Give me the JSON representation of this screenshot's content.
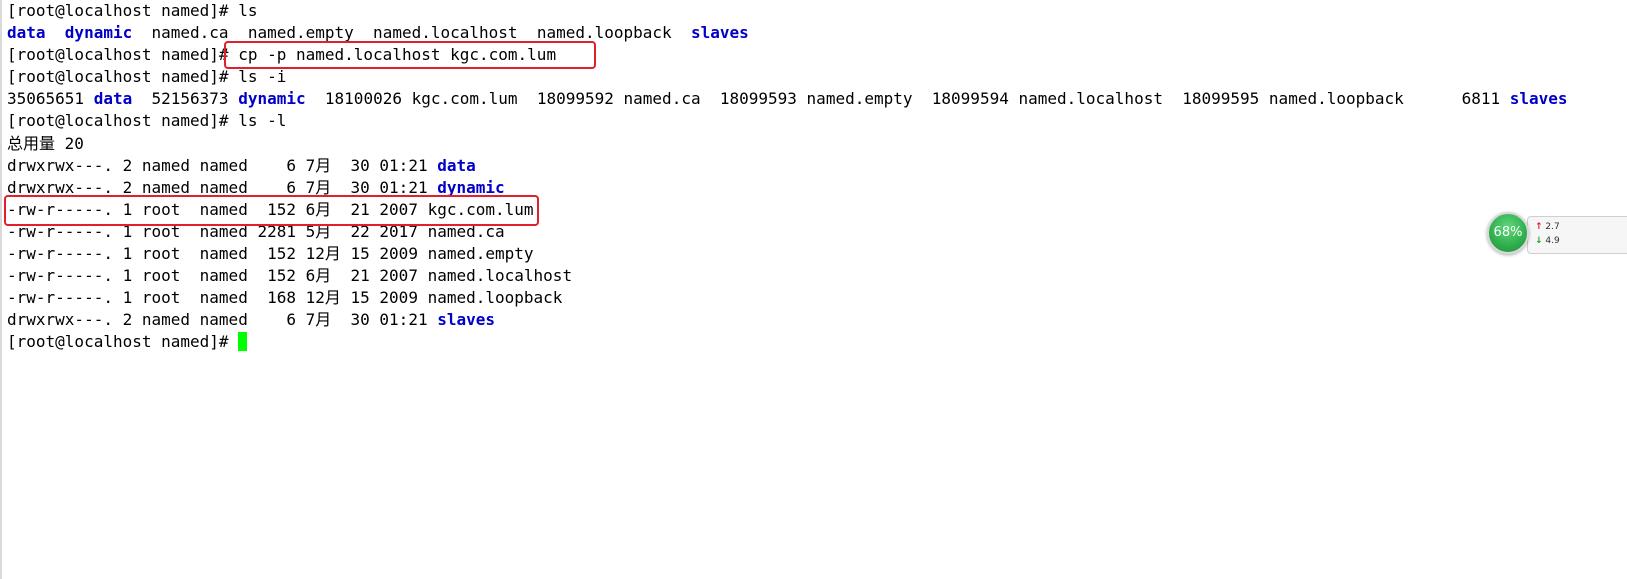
{
  "terminal": {
    "lines": [
      {
        "text": "[root@localhost named]# ls"
      },
      {
        "segments": [
          {
            "text": "data",
            "type": "dir"
          },
          {
            "text": "  "
          },
          {
            "text": "dynamic",
            "type": "dir"
          },
          {
            "text": "  named.ca  named.empty  named.localhost  named.loopback  "
          },
          {
            "text": "slaves",
            "type": "dir"
          }
        ]
      },
      {
        "text": "[root@localhost named]# cp -p named.localhost kgc.com.lum"
      },
      {
        "text": "[root@localhost named]# ls -i"
      },
      {
        "segments": [
          {
            "text": "35065651 "
          },
          {
            "text": "data",
            "type": "dir"
          },
          {
            "text": "  52156373 "
          },
          {
            "text": "dynamic",
            "type": "dir"
          },
          {
            "text": "  18100026 kgc.com.lum  18099592 named.ca  18099593 named.empty  18099594 named.localhost  18099595 named.loopback      6811 "
          },
          {
            "text": "slaves",
            "type": "dir"
          }
        ]
      },
      {
        "text": "[root@localhost named]# ls -l"
      },
      {
        "text": "总用量 20"
      },
      {
        "segments": [
          {
            "text": "drwxrwx---. 2 named named    6 7月  30 01:21 "
          },
          {
            "text": "data",
            "type": "dir"
          }
        ]
      },
      {
        "segments": [
          {
            "text": "drwxrwx---. 2 named named    6 7月  30 01:21 "
          },
          {
            "text": "dynamic",
            "type": "dir"
          }
        ]
      },
      {
        "text": "-rw-r-----. 1 root  named  152 6月  21 2007 kgc.com.lum"
      },
      {
        "text": "-rw-r-----. 1 root  named 2281 5月  22 2017 named.ca"
      },
      {
        "text": "-rw-r-----. 1 root  named  152 12月 15 2009 named.empty"
      },
      {
        "text": "-rw-r-----. 1 root  named  152 6月  21 2007 named.localhost"
      },
      {
        "text": "-rw-r-----. 1 root  named  168 12月 15 2009 named.loopback"
      },
      {
        "segments": [
          {
            "text": "drwxrwx---. 2 named named    6 7月  30 01:21 "
          },
          {
            "text": "slaves",
            "type": "dir"
          }
        ]
      },
      {
        "text": "[root@localhost named]# ",
        "cursor": true
      }
    ]
  },
  "net_widget": {
    "percent": "68%",
    "upload": "2.7",
    "download": "4.9"
  },
  "colors": {
    "directory": "#0000c8",
    "cursor": "#00ff00",
    "annotation": "#e0202a",
    "gauge": "#2fae4d"
  }
}
